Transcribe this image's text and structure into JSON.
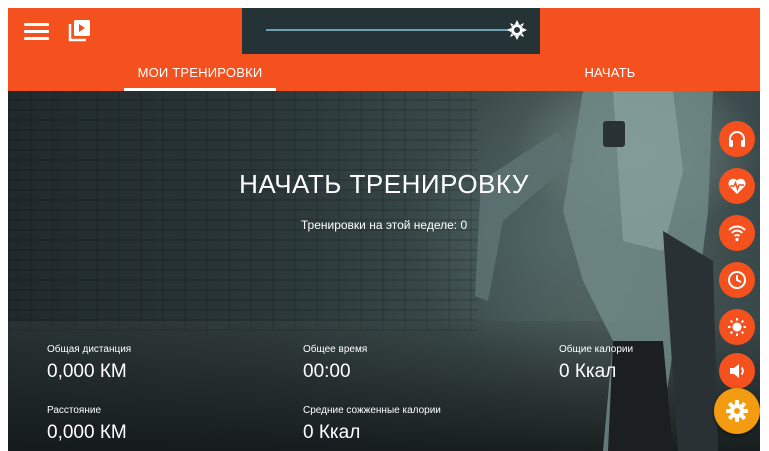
{
  "header": {
    "menu_icon": "hamburger-menu-icon",
    "playlist_icon": "video-playlist-icon",
    "brightness_slider": {
      "icon": "brightness-icon",
      "level": 1.0
    },
    "tabs": [
      {
        "label": "МОИ ТРЕНИРОВКИ",
        "active": true
      },
      {
        "label": "НАЧАТЬ",
        "active": false
      }
    ]
  },
  "hero": {
    "title": "НАЧАТЬ ТРЕНИРОВКУ",
    "subtitle": "Тренировки на этой неделе: 0"
  },
  "stats": [
    {
      "label": "Общая дистанция",
      "value": "0,000 КМ"
    },
    {
      "label": "Общее время",
      "value": "00:00"
    },
    {
      "label": "Общие калории",
      "value": "0 Ккал"
    },
    {
      "label": "Расстояние",
      "value": "0,000 КМ"
    },
    {
      "label": "Средние сожженные калории",
      "value": "0 Ккал"
    }
  ],
  "side_buttons": [
    "headphones-icon",
    "heart-rate-icon",
    "wifi-icon",
    "clock-icon",
    "brightness-icon",
    "volume-icon"
  ],
  "settings_button": "settings-gear-icon",
  "colors": {
    "accent": "#f4511e",
    "panel": "#253236",
    "slider": "#6c9fb3",
    "settings_fab": "#f39c12"
  }
}
